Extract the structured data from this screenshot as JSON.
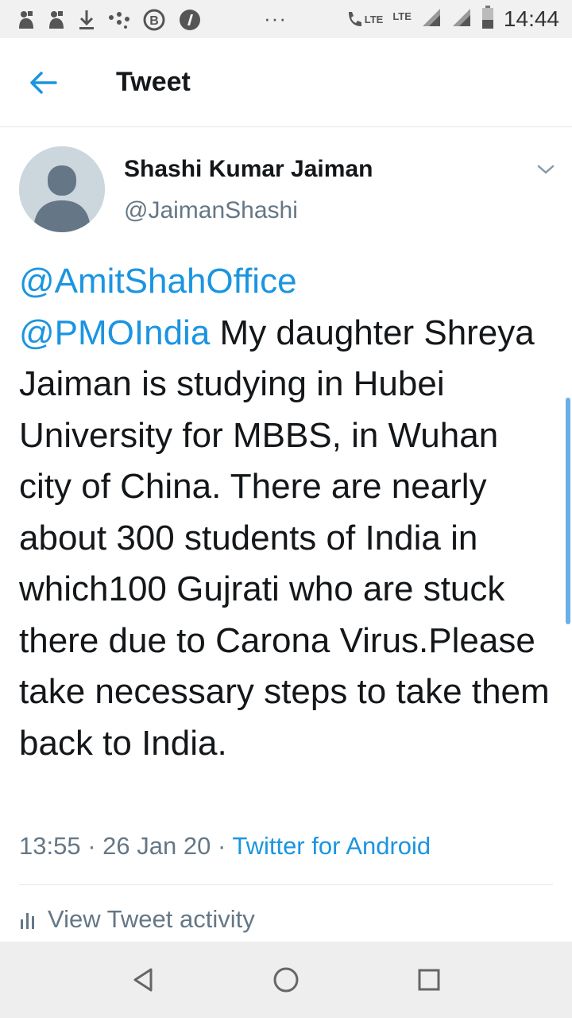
{
  "status_bar": {
    "time": "14:44",
    "network_1": "LTE",
    "network_2": "LTE",
    "overflow": "···",
    "icons": [
      "notification-icon",
      "notification-icon",
      "download-icon",
      "dots-icon",
      "b-icon",
      "apps-icon",
      "call-icon",
      "signal-icon",
      "signal-icon",
      "battery-icon"
    ]
  },
  "header": {
    "title": "Tweet",
    "back_icon": "arrow-left-icon"
  },
  "tweet": {
    "author_name": "Shashi Kumar Jaiman",
    "author_handle": "@JaimanShashi",
    "mention_1": "@AmitShahOffice",
    "mention_2": "@PMOIndia",
    "text": " My daughter Shreya Jaiman is studying in Hubei University for MBBS, in Wuhan city of China. There are nearly about 300 students of India in which100 Gujrati who are stuck there due to Carona Virus.Please take necessary steps to take them back to India.",
    "time": "13:55",
    "date": "26 Jan 20",
    "separator": "·",
    "source": "Twitter for Android",
    "activity_label": "View Tweet activity"
  },
  "colors": {
    "accent": "#1b95e0",
    "secondary_text": "#657786",
    "primary_text": "#14171a"
  }
}
